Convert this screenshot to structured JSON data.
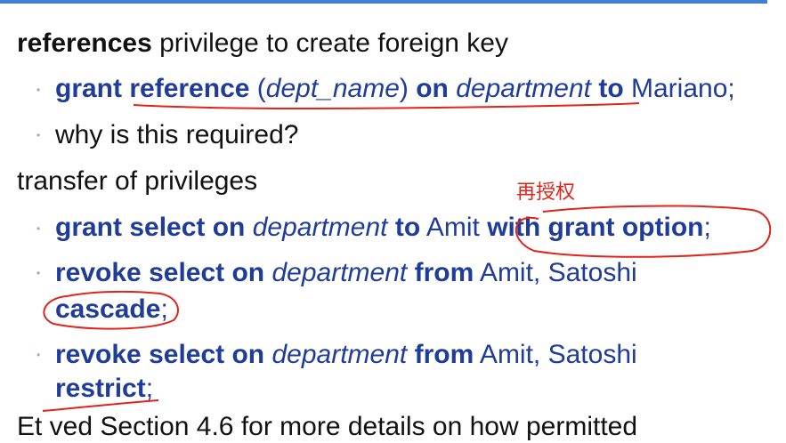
{
  "slide": {
    "line1": {
      "kw": "references",
      "rest": " privilege to create foreign key"
    },
    "line2": {
      "grant": "grant",
      "ref": "reference",
      "lp": " (",
      "dept_name": "dept_name",
      "rp": ") ",
      "on": "on",
      "department": "department",
      "to": "to",
      "user": " Mariano;"
    },
    "line3": {
      "text": "why is this required?"
    },
    "line4": {
      "text": "transfer of privileges"
    },
    "line5": {
      "grant_select_on": "grant select on",
      "department": "department",
      "to": "to",
      "amit": " Amit ",
      "with_grant_option": "with grant option",
      "semi": ";"
    },
    "line6": {
      "revoke_select_on": "revoke select on",
      "department": "department",
      "from": "from",
      "users": " Amit, Satoshi"
    },
    "line7": {
      "cascade": "cascade",
      "semi": ";"
    },
    "line8": {
      "revoke_select_on": "revoke select on",
      "department": "department",
      "from": "from",
      "users": " Amit, Satoshi"
    },
    "line9": {
      "restrict": "restrict",
      "semi": ";"
    },
    "line10": {
      "text": "Et      ved Section 4.6 for more details on how permitted"
    }
  },
  "annotation": {
    "note": "再授权"
  },
  "colors": {
    "accent": "#1f3c98",
    "ink": "#111111",
    "annotation": "#e2231a",
    "bar": "#3f7fd6"
  }
}
